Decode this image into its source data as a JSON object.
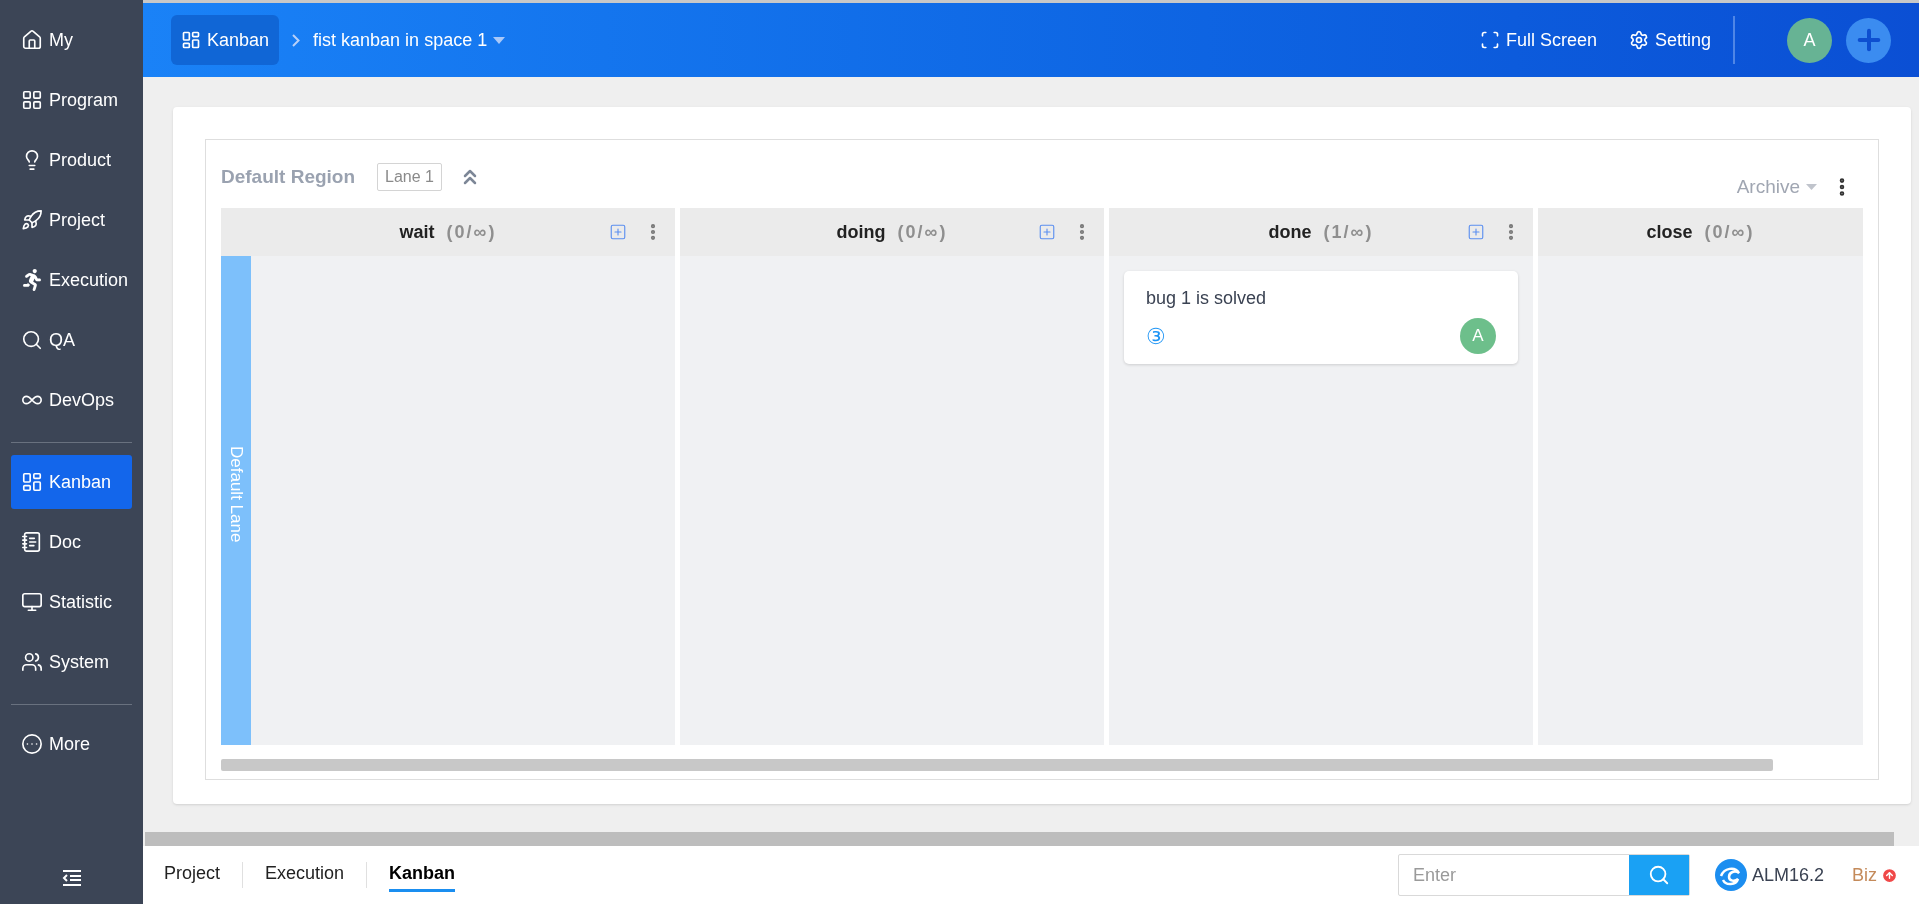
{
  "sidebar": {
    "groups": [
      [
        {
          "label": "My",
          "selected": false
        },
        {
          "label": "Program",
          "selected": false
        },
        {
          "label": "Product",
          "selected": false
        },
        {
          "label": "Project",
          "selected": false
        },
        {
          "label": "Execution",
          "selected": false
        },
        {
          "label": "QA",
          "selected": false
        },
        {
          "label": "DevOps",
          "selected": false
        }
      ],
      [
        {
          "label": "Kanban",
          "selected": true
        },
        {
          "label": "Doc",
          "selected": false
        },
        {
          "label": "Statistic",
          "selected": false
        },
        {
          "label": "System",
          "selected": false
        }
      ],
      [
        {
          "label": "More",
          "selected": false
        }
      ]
    ]
  },
  "topbar": {
    "app": "Kanban",
    "board": "fist kanban in space 1",
    "actions": [
      "Full Screen",
      "Setting"
    ],
    "avatar": "A"
  },
  "region": {
    "title": "Default Region",
    "lane_tag": "Lane 1",
    "archive": "Archive",
    "lane": "Default Lane",
    "columns": [
      {
        "name": "wait",
        "count": "(0/∞)",
        "has_actions": true
      },
      {
        "name": "doing",
        "count": "(0/∞)",
        "has_actions": true
      },
      {
        "name": "done",
        "count": "(1/∞)",
        "has_actions": true,
        "cards": [
          {
            "title": "bug 1 is solved",
            "priority": "③",
            "assignee": "A"
          }
        ]
      },
      {
        "name": "close",
        "count": "(0/∞)",
        "has_actions": false
      }
    ]
  },
  "bottom": {
    "tabs": [
      {
        "label": "Project",
        "selected": false
      },
      {
        "label": "Execution",
        "selected": false
      },
      {
        "label": "Kanban",
        "selected": true
      }
    ],
    "search": {
      "placeholder": "Enter"
    },
    "version": "ALM16.2",
    "edition": "Biz"
  }
}
